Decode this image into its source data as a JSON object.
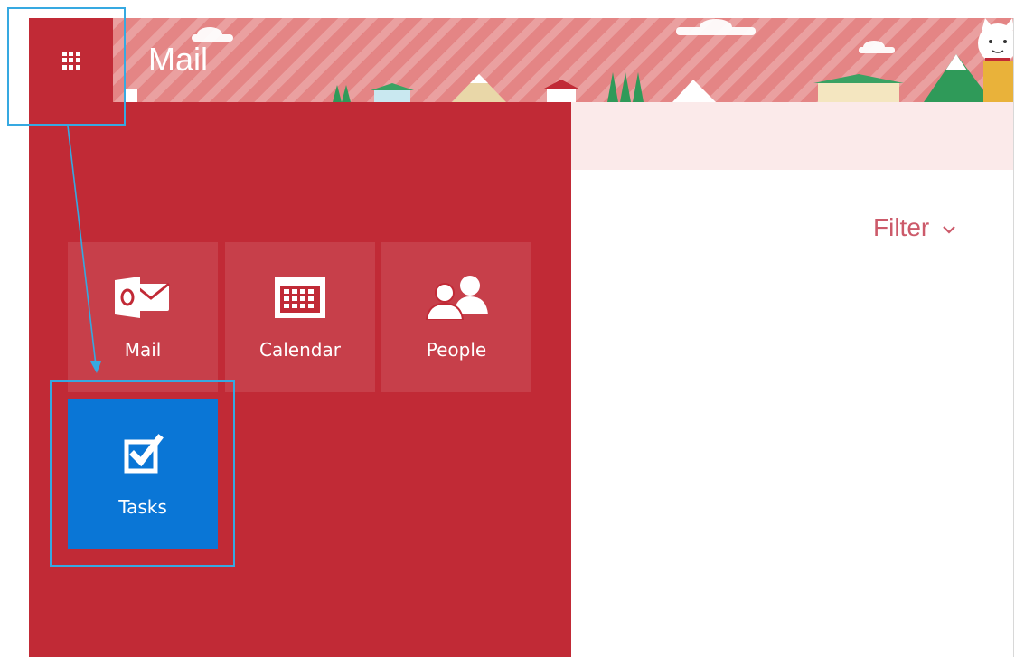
{
  "header": {
    "app_title": "Mail",
    "launcher_icon": "waffle-grid-icon",
    "mascot_icon": "lucky-cat-icon"
  },
  "launcher": {
    "tiles": [
      {
        "label": "Mail",
        "icon": "outlook-icon"
      },
      {
        "label": "Calendar",
        "icon": "calendar-icon"
      },
      {
        "label": "People",
        "icon": "people-icon"
      },
      {
        "label": "Tasks",
        "icon": "tasks-checkbox-icon"
      }
    ]
  },
  "right_pane": {
    "filter_label": "Filter",
    "filter_icon": "chevron-down-icon"
  },
  "colors": {
    "panel": "#c12a36",
    "tile": "rgba(255,255,255,0.10)",
    "tasks_tile": "#0a76d6",
    "header": "#e48585",
    "filter_text": "#cc5a6a",
    "annotation": "#36a9e1"
  }
}
